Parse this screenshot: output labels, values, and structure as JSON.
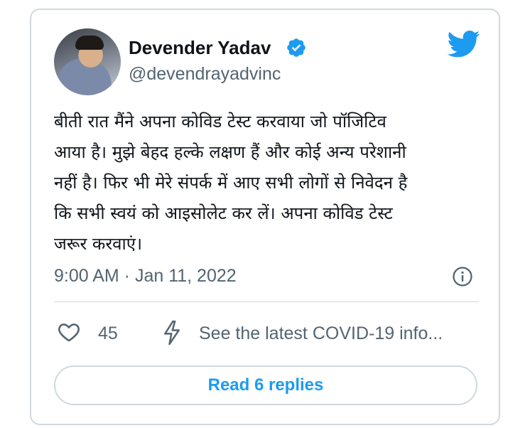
{
  "tweet": {
    "author": {
      "name": "Devender Yadav",
      "handle": "@devendrayadvinc",
      "verified": true
    },
    "text": "बीती रात मैंने अपना कोविड टेस्ट करवाया जो पॉजिटिव\nआया है। मुझे बेहद हल्के लक्षण हैं और कोई अन्य परेशानी\nनहीं है। फिर भी मेरे संपर्क में आए सभी लोगों से निवेदन है\nकि सभी स्वयं को आइसोलेट कर लें। अपना कोविड टेस्ट\nजरूर करवाएं।",
    "timestamp": "9:00 AM · Jan 11, 2022",
    "likes": "45",
    "covid_link": "See the latest COVID-19 info...",
    "replies_button": "Read 6 replies"
  },
  "icons": {
    "verified": "verified-badge-icon",
    "platform": "twitter-bird-icon",
    "info": "info-icon",
    "like": "heart-icon",
    "covid": "lightning-bolt-icon"
  },
  "colors": {
    "accent": "#1d9bf0",
    "secondary_text": "#536471",
    "border": "#cfd9de"
  }
}
